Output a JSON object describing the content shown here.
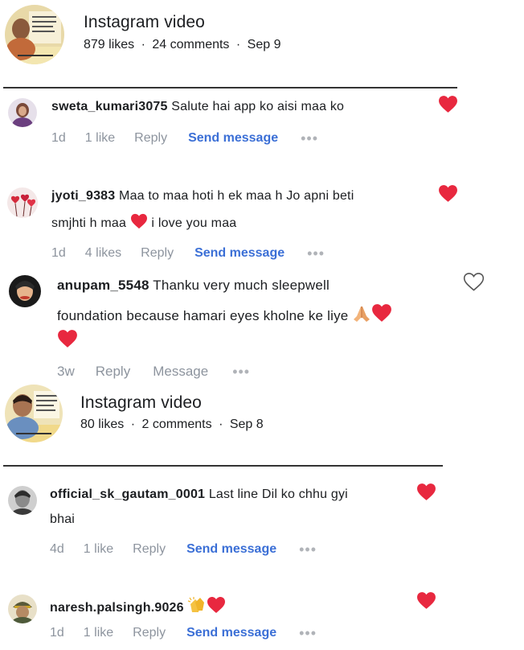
{
  "posts": [
    {
      "title": "Instagram video",
      "likes": "879 likes",
      "comments": "24 comments",
      "date": "Sep 9",
      "sep": "·"
    },
    {
      "title": "Instagram video",
      "likes": "80 likes",
      "comments": "2 comments",
      "date": "Sep 8",
      "sep": "·"
    }
  ],
  "comments": [
    {
      "username": "sweta_kumari3075",
      "text1": "Salute hai app ko aisi maa ko",
      "time": "1d",
      "likes": "1 like",
      "reply": "Reply",
      "send": "Send message",
      "more": "•••"
    },
    {
      "username": "jyoti_9383",
      "text1": "Maa to maa hoti h ek maa h Jo apni beti",
      "text2a": "smjhti h maa",
      "text2b": "i love you maa",
      "time": "1d",
      "likes": "4 likes",
      "reply": "Reply",
      "send": "Send message",
      "more": "•••"
    },
    {
      "username": "anupam_5548",
      "text1": "Thanku very much sleepwell",
      "text2": "foundation because hamari eyes kholne ke liye",
      "time": "3w",
      "reply": "Reply",
      "message": "Message",
      "more": "•••"
    },
    {
      "username": "official_sk_gautam_0001",
      "text1": "Last line Dil ko chhu gyi",
      "text2": "bhai",
      "time": "4d",
      "likes": "1 like",
      "reply": "Reply",
      "send": "Send message",
      "more": "•••"
    },
    {
      "username": "naresh.palsingh.9026",
      "time": "1d",
      "likes": "1 like",
      "reply": "Reply",
      "send": "Send message",
      "more": "•••"
    }
  ],
  "icons": {
    "liked_heart": "heart-filled-icon",
    "unliked_heart": "heart-outline-icon"
  },
  "colors": {
    "accent": "#3b6fd6",
    "heart": "#e8283f",
    "muted": "#8d949e"
  }
}
